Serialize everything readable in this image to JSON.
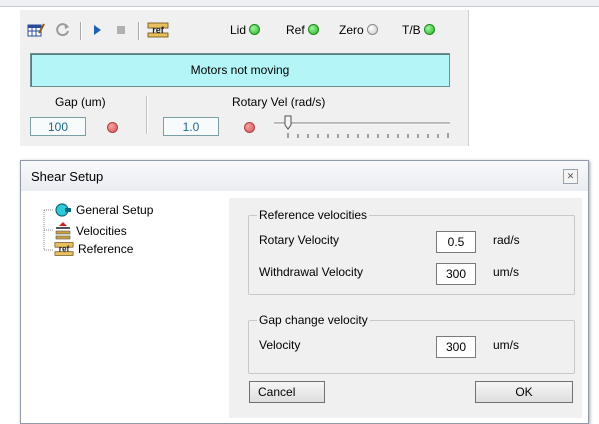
{
  "panel": {
    "indicators": [
      {
        "label": "Lid",
        "state": "on",
        "color": "#22b522"
      },
      {
        "label": "Ref",
        "state": "on",
        "color": "#22b522"
      },
      {
        "label": "Zero",
        "state": "off",
        "color": "#c8c8c8"
      },
      {
        "label": "T/B",
        "state": "on",
        "color": "#22b522"
      }
    ],
    "status_text": "Motors not moving",
    "status_color": "#b4f6f8",
    "gap": {
      "label": "Gap (um)",
      "value": "100"
    },
    "rotary": {
      "label": "Rotary Vel (rad/s)",
      "value": "1.0"
    },
    "icons": [
      "grid-edit-icon",
      "refresh-icon",
      "play-icon",
      "stop-icon",
      "ref-icon"
    ]
  },
  "dialog": {
    "title": "Shear Setup",
    "tree": [
      {
        "label": "General Setup",
        "icon": "general-setup-icon"
      },
      {
        "label": "Velocities",
        "icon": "velocities-icon"
      },
      {
        "label": "Reference",
        "icon": "ref-icon"
      }
    ],
    "ref_group": {
      "title": "Reference velocities",
      "rotary": {
        "label": "Rotary Velocity",
        "value": "0.5",
        "unit": "rad/s"
      },
      "withdrawal": {
        "label": "Withdrawal Velocity",
        "value": "300",
        "unit": "um/s"
      }
    },
    "gap_group": {
      "title": "Gap change velocity",
      "velocity": {
        "label": "Velocity",
        "value": "300",
        "unit": "um/s"
      }
    },
    "cancel_label": "Cancel",
    "ok_label": "OK"
  }
}
